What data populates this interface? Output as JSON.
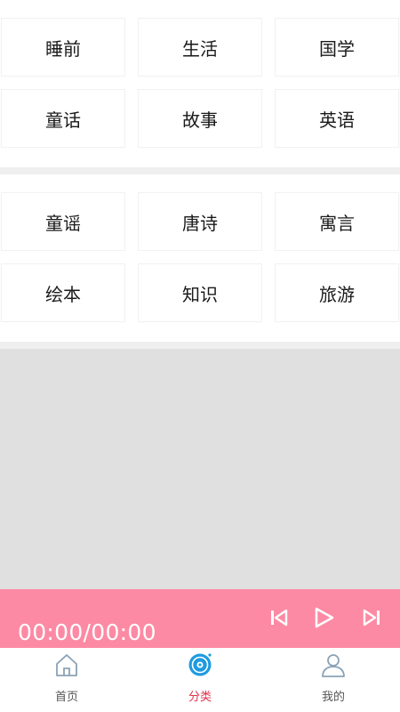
{
  "categories_group1": [
    [
      "睡前",
      "生活",
      "国学"
    ],
    [
      "童话",
      "故事",
      "英语"
    ]
  ],
  "categories_group2": [
    [
      "童谣",
      "唐诗",
      "寓言"
    ],
    [
      "绘本",
      "知识",
      "旅游"
    ]
  ],
  "player": {
    "time": "00:00/00:00",
    "controls": [
      "previous-icon",
      "play-icon",
      "next-icon"
    ]
  },
  "tabbar": {
    "tabs": [
      {
        "label": "首页",
        "icon": "home-icon",
        "active": false
      },
      {
        "label": "分类",
        "icon": "category-disc-icon",
        "active": true
      },
      {
        "label": "我的",
        "icon": "user-icon",
        "active": false
      }
    ]
  },
  "colors": {
    "player_bg": "#fd8aa4",
    "active_tab": "#e0314b",
    "active_icon": "#1e9be0",
    "icon_gray": "#8aa2b6"
  }
}
